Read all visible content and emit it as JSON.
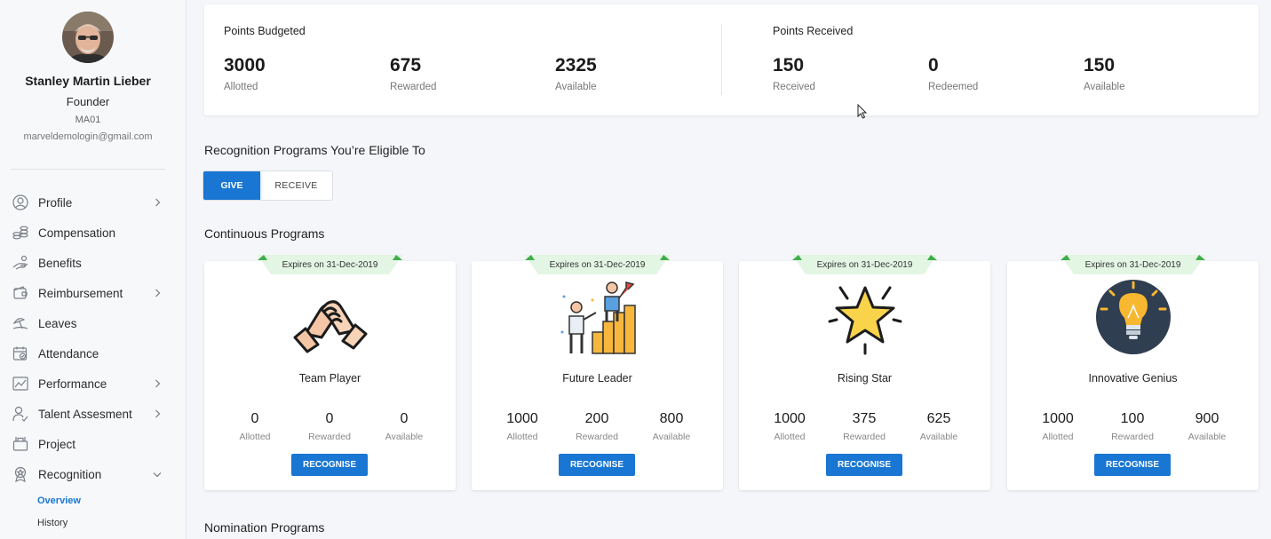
{
  "user": {
    "name": "Stanley Martin Lieber",
    "role": "Founder",
    "code": "MA01",
    "email": "marveldemologin@gmail.com"
  },
  "nav": {
    "items": [
      {
        "label": "Profile",
        "icon": "user-circle-icon",
        "chevron": "right"
      },
      {
        "label": "Compensation",
        "icon": "coins-icon",
        "chevron": ""
      },
      {
        "label": "Benefits",
        "icon": "hand-icon",
        "chevron": ""
      },
      {
        "label": "Reimbursement",
        "icon": "wallet-icon",
        "chevron": "right"
      },
      {
        "label": "Leaves",
        "icon": "beach-icon",
        "chevron": ""
      },
      {
        "label": "Attendance",
        "icon": "calendar-check-icon",
        "chevron": ""
      },
      {
        "label": "Performance",
        "icon": "chart-icon",
        "chevron": "right"
      },
      {
        "label": "Talent Assesment",
        "icon": "person-icon",
        "chevron": "right"
      },
      {
        "label": "Project",
        "icon": "briefcase-icon",
        "chevron": ""
      },
      {
        "label": "Recognition",
        "icon": "award-icon",
        "chevron": "down"
      }
    ],
    "sub_items": [
      {
        "label": "Overview",
        "active": true
      },
      {
        "label": "History",
        "active": false
      }
    ]
  },
  "points_budgeted": {
    "title": "Points Budgeted",
    "stats": [
      {
        "value": "3000",
        "label": "Allotted"
      },
      {
        "value": "675",
        "label": "Rewarded"
      },
      {
        "value": "2325",
        "label": "Available"
      }
    ]
  },
  "points_received": {
    "title": "Points Received",
    "stats": [
      {
        "value": "150",
        "label": "Received"
      },
      {
        "value": "0",
        "label": "Redeemed"
      },
      {
        "value": "150",
        "label": "Available"
      }
    ]
  },
  "recognition": {
    "eligible_title": "Recognition Programs You’re Eligible To",
    "toggle": {
      "give": "GIVE",
      "receive": "RECEIVE",
      "selected": "give"
    },
    "continuous_title": "Continuous Programs",
    "nomination_title": "Nomination Programs",
    "programs": [
      {
        "name": "Team Player",
        "expires": "Expires on 31-Dec-2019",
        "icon": "handshake-icon",
        "allotted": "0",
        "rewarded": "0",
        "available": "0",
        "button": "RECOGNISE"
      },
      {
        "name": "Future Leader",
        "expires": "Expires on 31-Dec-2019",
        "icon": "podium-leader-icon",
        "allotted": "1000",
        "rewarded": "200",
        "available": "800",
        "button": "RECOGNISE"
      },
      {
        "name": "Rising Star",
        "expires": "Expires on 31-Dec-2019",
        "icon": "star-icon",
        "allotted": "1000",
        "rewarded": "375",
        "available": "625",
        "button": "RECOGNISE"
      },
      {
        "name": "Innovative Genius",
        "expires": "Expires on 31-Dec-2019",
        "icon": "lightbulb-icon",
        "allotted": "1000",
        "rewarded": "100",
        "available": "900",
        "button": "RECOGNISE"
      }
    ],
    "stat_labels": {
      "allotted": "Allotted",
      "rewarded": "Rewarded",
      "available": "Available"
    }
  },
  "colors": {
    "primary": "#1976d2",
    "ribbon": "#e3f5e3",
    "ribbon_edge": "#3fae4a"
  }
}
